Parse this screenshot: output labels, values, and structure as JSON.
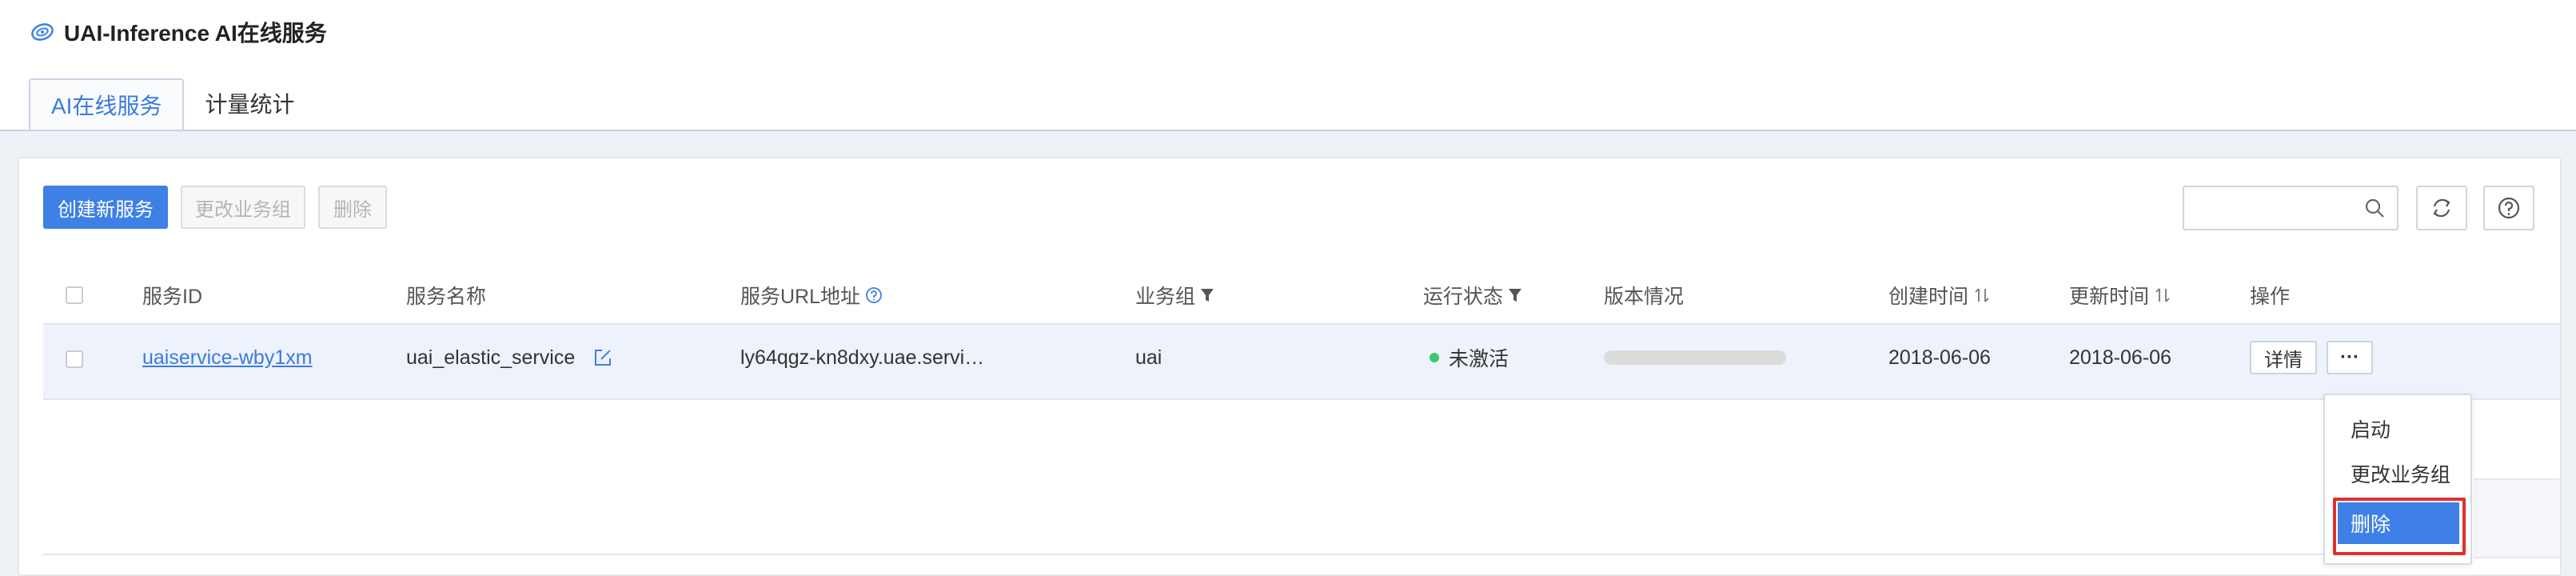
{
  "app": {
    "title": "UAI-Inference AI在线服务"
  },
  "tabs": [
    {
      "label": "AI在线服务",
      "active": true
    },
    {
      "label": "计量统计",
      "active": false
    }
  ],
  "toolbar": {
    "create_label": "创建新服务",
    "change_group_label": "更改业务组",
    "delete_label": "删除",
    "search_placeholder": ""
  },
  "table": {
    "columns": [
      "服务ID",
      "服务名称",
      "服务URL地址",
      "业务组",
      "运行状态",
      "版本情况",
      "创建时间",
      "更新时间",
      "操作"
    ],
    "rows": [
      {
        "service_id": "uaiservice-wby1xm",
        "service_name": "uai_elastic_service",
        "url": "ly64qgz-kn8dxy.uae.servi…",
        "group": "uai",
        "status": "未激活",
        "created": "2018-06-06",
        "updated": "2018-06-06",
        "detail_label": "详情",
        "more_label": "···"
      }
    ]
  },
  "dropdown_menu": {
    "items": [
      {
        "label": "启动",
        "selected": false
      },
      {
        "label": "更改业务组",
        "selected": false
      },
      {
        "label": "删除",
        "selected": true
      }
    ]
  },
  "colors": {
    "accent": "#3e80e6",
    "status_inactive_dot": "#3fc66b",
    "highlight_border": "#e0302a"
  }
}
